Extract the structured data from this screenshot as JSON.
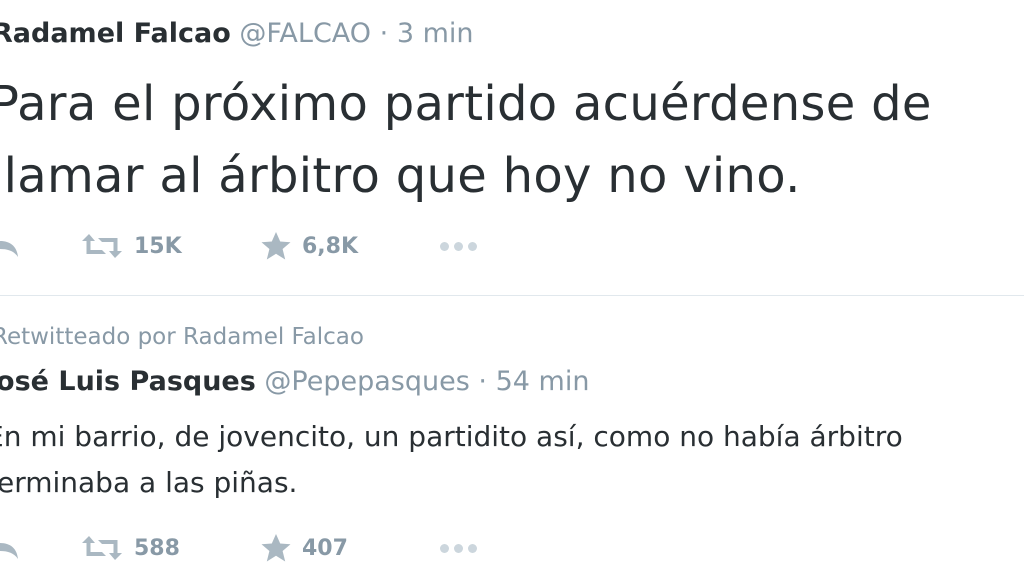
{
  "tweets": [
    {
      "name": "Radamel Falcao",
      "handle": "@FALCAO",
      "separator": "·",
      "time": "3 min",
      "text": "Para el próximo  partido acuérdense de\nllamar al árbitro que hoy no vino.",
      "retweets": "15K",
      "favorites": "6,8K"
    },
    {
      "retweet_context": "Retwitteado por Radamel Falcao",
      "name": "José Luis Pasques",
      "handle": "@Pepepasques",
      "separator": "·",
      "time": "54 min",
      "text": "En mi barrio, de jovencito, un partidito así, como no había árbitro\nterminaba a las piñas.",
      "retweets": "588",
      "favorites": "407"
    }
  ],
  "icons": {
    "reply": "reply-icon",
    "retweet": "retweet-icon",
    "favorite": "star-icon",
    "more": "more-dots-icon"
  },
  "colors": {
    "text": "#292f33",
    "muted": "#8899a6",
    "icon": "#aab8c2",
    "divider": "#e1e8ed"
  }
}
